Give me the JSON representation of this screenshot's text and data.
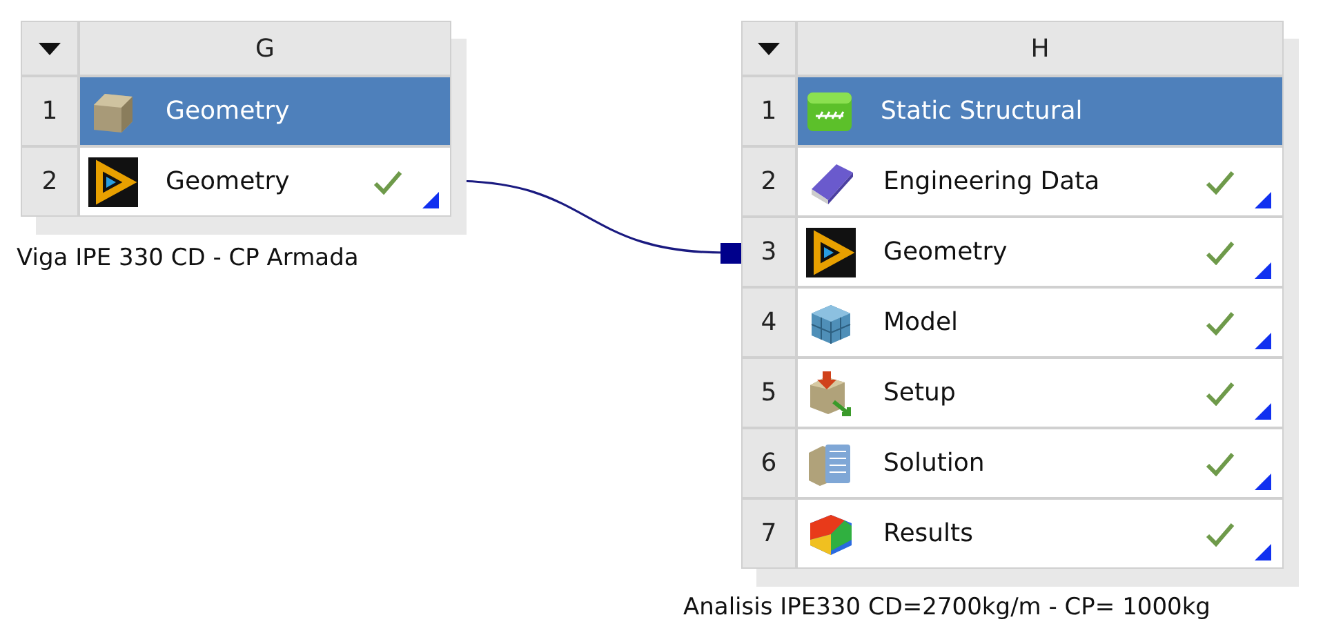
{
  "systems": [
    {
      "letter": "G",
      "caption": "Viga IPE 330 CD - CP Armada",
      "cells": [
        {
          "number": "1",
          "label": "Geometry",
          "kind": "block",
          "selected": true,
          "up_to_date": false
        },
        {
          "number": "2",
          "label": "Geometry",
          "kind": "geometry",
          "selected": false,
          "up_to_date": true
        }
      ]
    },
    {
      "letter": "H",
      "caption": "Analisis IPE330 CD=2700kg/m - CP= 1000kg",
      "cells": [
        {
          "number": "1",
          "label": "Static Structural",
          "kind": "structural",
          "selected": true,
          "up_to_date": false
        },
        {
          "number": "2",
          "label": "Engineering Data",
          "kind": "materials",
          "selected": false,
          "up_to_date": true
        },
        {
          "number": "3",
          "label": "Geometry",
          "kind": "geometry",
          "selected": false,
          "up_to_date": true
        },
        {
          "number": "4",
          "label": "Model",
          "kind": "model",
          "selected": false,
          "up_to_date": true
        },
        {
          "number": "5",
          "label": "Setup",
          "kind": "setup",
          "selected": false,
          "up_to_date": true
        },
        {
          "number": "6",
          "label": "Solution",
          "kind": "solution",
          "selected": false,
          "up_to_date": true
        },
        {
          "number": "7",
          "label": "Results",
          "kind": "results",
          "selected": false,
          "up_to_date": true
        }
      ]
    }
  ]
}
